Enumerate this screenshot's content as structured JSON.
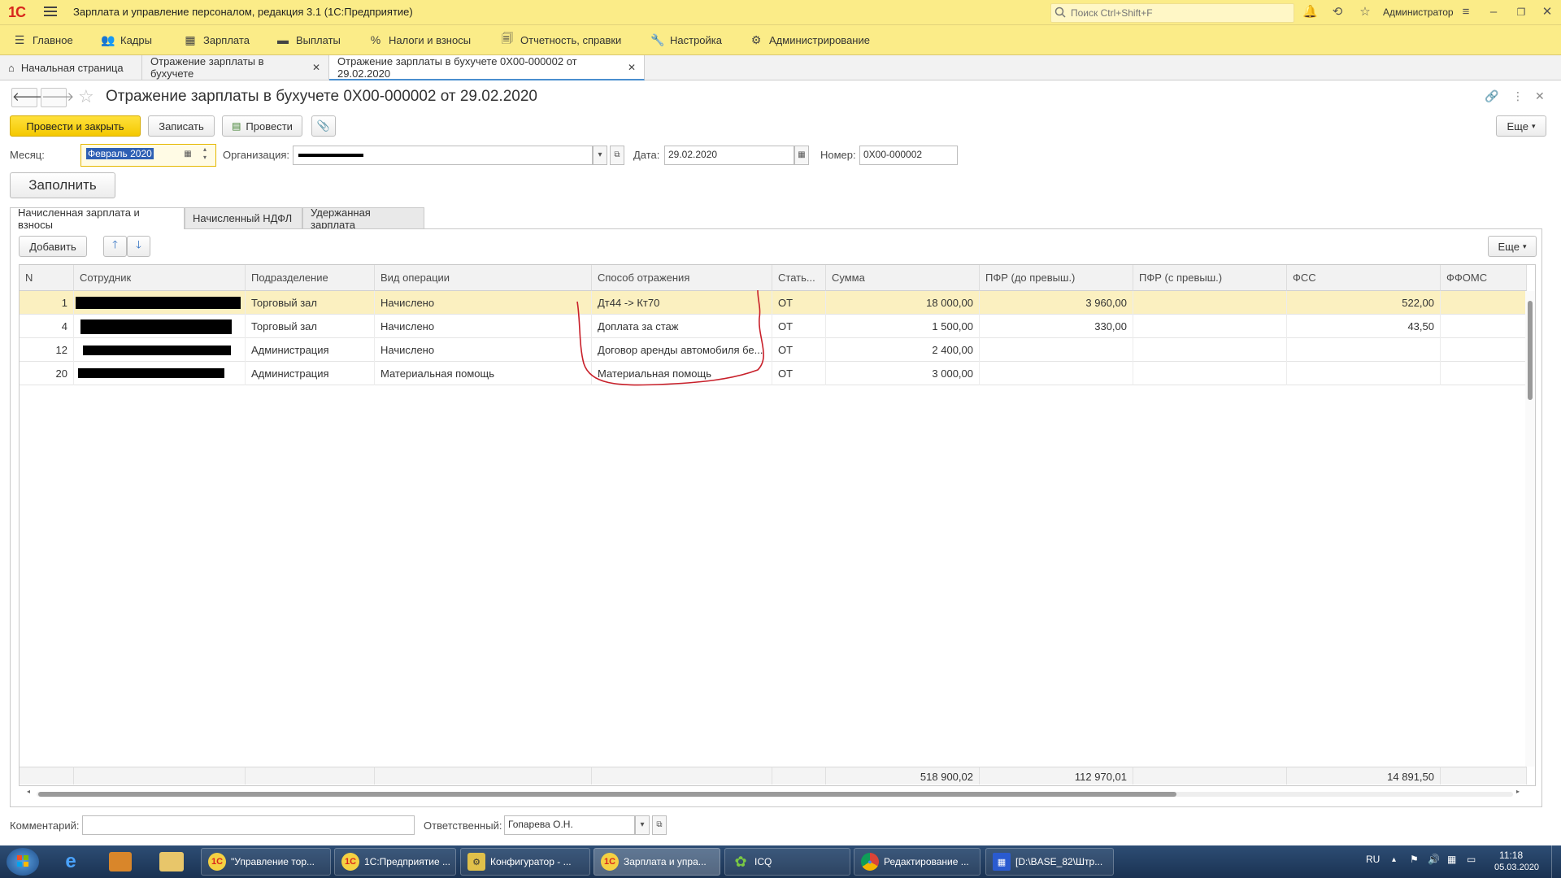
{
  "app": {
    "logo": "1С",
    "title": "Зарплата и управление персоналом, редакция 3.1  (1С:Предприятие)",
    "search_placeholder": "Поиск Ctrl+Shift+F",
    "user": "Администратор"
  },
  "sections": [
    {
      "label": "Главное",
      "icon": "☰"
    },
    {
      "label": "Кадры",
      "icon": "👥"
    },
    {
      "label": "Зарплата",
      "icon": "▦"
    },
    {
      "label": "Выплаты",
      "icon": "▬"
    },
    {
      "label": "Налоги и взносы",
      "icon": "%"
    },
    {
      "label": "Отчетность, справки",
      "icon": "🗐"
    },
    {
      "label": "Настройка",
      "icon": "🔧"
    },
    {
      "label": "Администрирование",
      "icon": "⚙"
    }
  ],
  "tabs": [
    {
      "label": "Начальная страница",
      "closable": false
    },
    {
      "label": "Отражение зарплаты в бухучете",
      "closable": true
    },
    {
      "label": "Отражение зарплаты в бухучете 0Х00-000002 от 29.02.2020",
      "closable": true
    }
  ],
  "document": {
    "title": "Отражение зарплаты в бухучете 0Х00-000002 от 29.02.2020",
    "buttons": {
      "post_close": "Провести и закрыть",
      "save": "Записать",
      "post": "Провести",
      "more": "Еще",
      "fill": "Заполнить",
      "add": "Добавить"
    },
    "fields": {
      "month_label": "Месяц:",
      "month_value": "Февраль 2020",
      "org_label": "Организация:",
      "org_value": "",
      "date_label": "Дата:",
      "date_value": "29.02.2020",
      "number_label": "Номер:",
      "number_value": "0Х00-000002",
      "comment_label": "Комментарий:",
      "comment_value": "",
      "responsible_label": "Ответственный:",
      "responsible_value": "Гопарева О.Н."
    },
    "inner_tabs": [
      "Начисленная зарплата и взносы",
      "Начисленный НДФЛ",
      "Удержанная зарплата"
    ],
    "columns": [
      "N",
      "Сотрудник",
      "Подразделение",
      "Вид операции",
      "Способ отражения",
      "Стать...",
      "Сумма",
      "ПФР (до превыш.)",
      "ПФР (с превыш.)",
      "ФСС",
      "ФФОМС"
    ],
    "rows": [
      {
        "n": "1",
        "employee": "",
        "dept": "Торговый зал",
        "op": "Начислено",
        "method": "Дт44 -> Кт70",
        "article": "ОТ",
        "sum": "18 000,00",
        "pfr1": "3 960,00",
        "pfr2": "",
        "fss": "522,00",
        "ffoms": ""
      },
      {
        "n": "4",
        "employee": "",
        "dept": "Торговый зал",
        "op": "Начислено",
        "method": "Доплата за стаж",
        "article": "ОТ",
        "sum": "1 500,00",
        "pfr1": "330,00",
        "pfr2": "",
        "fss": "43,50",
        "ffoms": ""
      },
      {
        "n": "12",
        "employee": "",
        "dept": "Администрация",
        "op": "Начислено",
        "method": "Договор аренды автомобиля бе...",
        "article": "ОТ",
        "sum": "2 400,00",
        "pfr1": "",
        "pfr2": "",
        "fss": "",
        "ffoms": ""
      },
      {
        "n": "20",
        "employee": "",
        "dept": "Администрация",
        "op": "Материальная помощь",
        "method": "Материальная помощь",
        "article": "ОТ",
        "sum": "3 000,00",
        "pfr1": "",
        "pfr2": "",
        "fss": "",
        "ffoms": ""
      }
    ],
    "totals": {
      "sum": "518 900,02",
      "pfr1": "112 970,01",
      "fss": "14 891,50"
    }
  },
  "taskbar": {
    "items": [
      {
        "label": "\"Управление тор...",
        "icon": "1С"
      },
      {
        "label": "1С:Предприятие ...",
        "icon": "1С"
      },
      {
        "label": "Конфигуратор - ...",
        "icon": "⚙"
      },
      {
        "label": "Зарплата и упра...",
        "icon": "1С"
      },
      {
        "label": "ICQ",
        "icon": "✿"
      },
      {
        "label": "Редактирование ...",
        "icon": "●"
      },
      {
        "label": "[D:\\BASE_82\\Штр...",
        "icon": "▦"
      }
    ],
    "lang": "RU",
    "time": "11:18",
    "date": "05.03.2020"
  },
  "colors": {
    "accent_yellow": "#fbec88",
    "primary_button": "#f4c800",
    "selected_row": "#fbf0c0",
    "annotation_red": "#c8202a"
  }
}
